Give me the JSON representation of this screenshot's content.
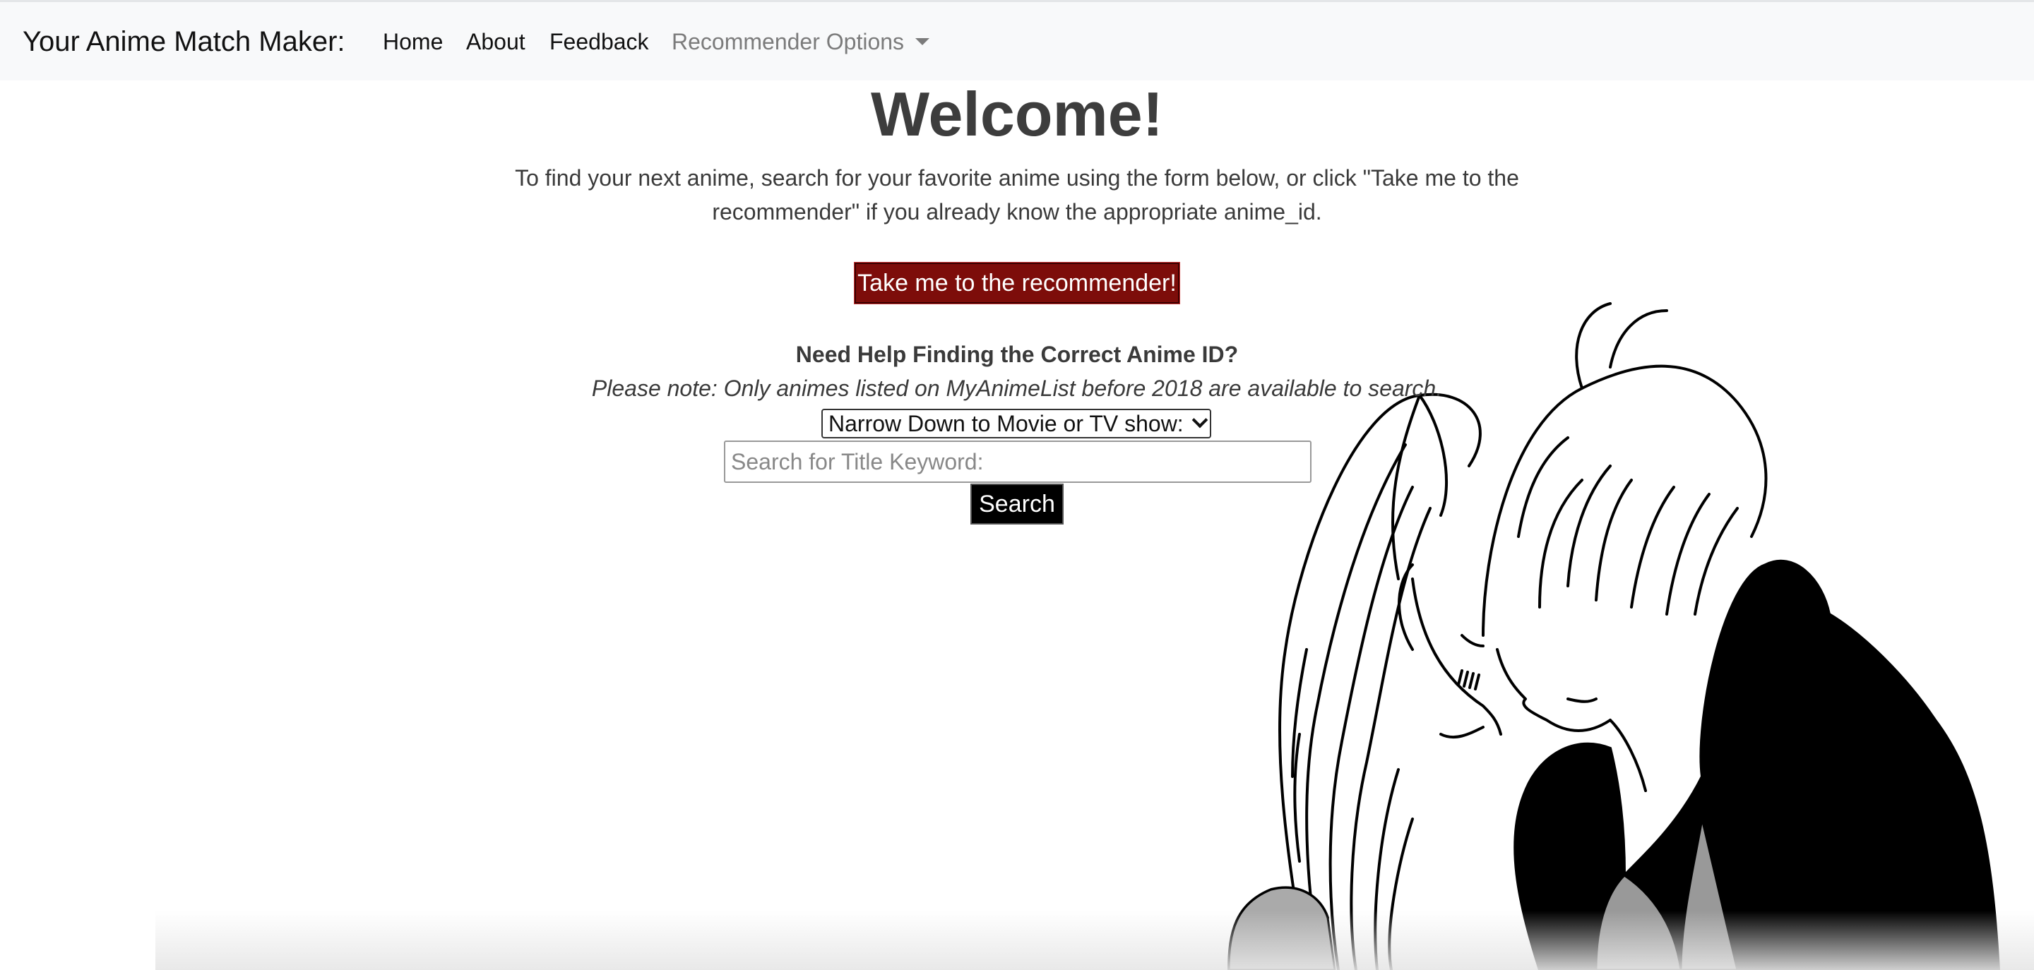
{
  "navbar": {
    "brand": "Your Anime Match Maker:",
    "links": [
      {
        "label": "Home"
      },
      {
        "label": "About"
      },
      {
        "label": "Feedback"
      }
    ],
    "dropdown_label": "Recommender Options"
  },
  "main": {
    "heading": "Welcome!",
    "intro_text": "To find your next anime, search for your favorite anime using the form below, or click \"Take me to the recommender\" if you already know the appropriate anime_id.",
    "recommender_button": "Take me to the recommender!",
    "help_heading": "Need Help Finding the Correct Anime ID?",
    "note": "Please note: Only animes listed on MyAnimeList before 2018 are available to search.",
    "type_select": {
      "selected": "Narrow Down to Movie or TV show:"
    },
    "search": {
      "placeholder": "Search for Title Keyword:",
      "value": "",
      "button_label": "Search"
    }
  },
  "colors": {
    "recommender_button_bg": "#7d0d0a",
    "search_button_bg": "#000000",
    "navbar_bg": "#f8f9fa"
  },
  "illustration": {
    "icon": "anime-couple-lineart"
  }
}
